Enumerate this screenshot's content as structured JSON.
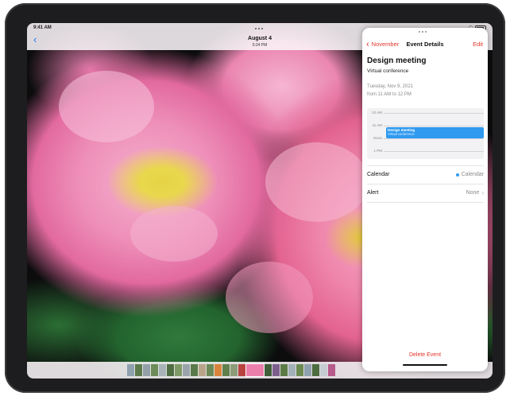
{
  "status": {
    "time": "9:41 AM"
  },
  "photo_header": {
    "date": "August 4",
    "time": "5:24 PM"
  },
  "panel": {
    "back_label": "November",
    "title": "Event Details",
    "edit_label": "Edit",
    "event": {
      "title": "Design meeting",
      "location": "Virtual conference",
      "date": "Tuesday, Nov 9, 2021",
      "time_range": "from 11 AM to 12 PM"
    },
    "timeline": {
      "labels": [
        "10 AM",
        "11 AM",
        "Noon",
        "1 PM"
      ],
      "event_title": "Design meeting",
      "event_sub": "Virtual conference"
    },
    "rows": [
      {
        "label": "Calendar",
        "value": "Calendar"
      },
      {
        "label": "Alert",
        "value": "None"
      }
    ],
    "delete_label": "Delete Event"
  },
  "colors": {
    "accent_red": "#e5352b",
    "event_blue": "#2f9af0",
    "back_blue": "#1a7cf5"
  }
}
